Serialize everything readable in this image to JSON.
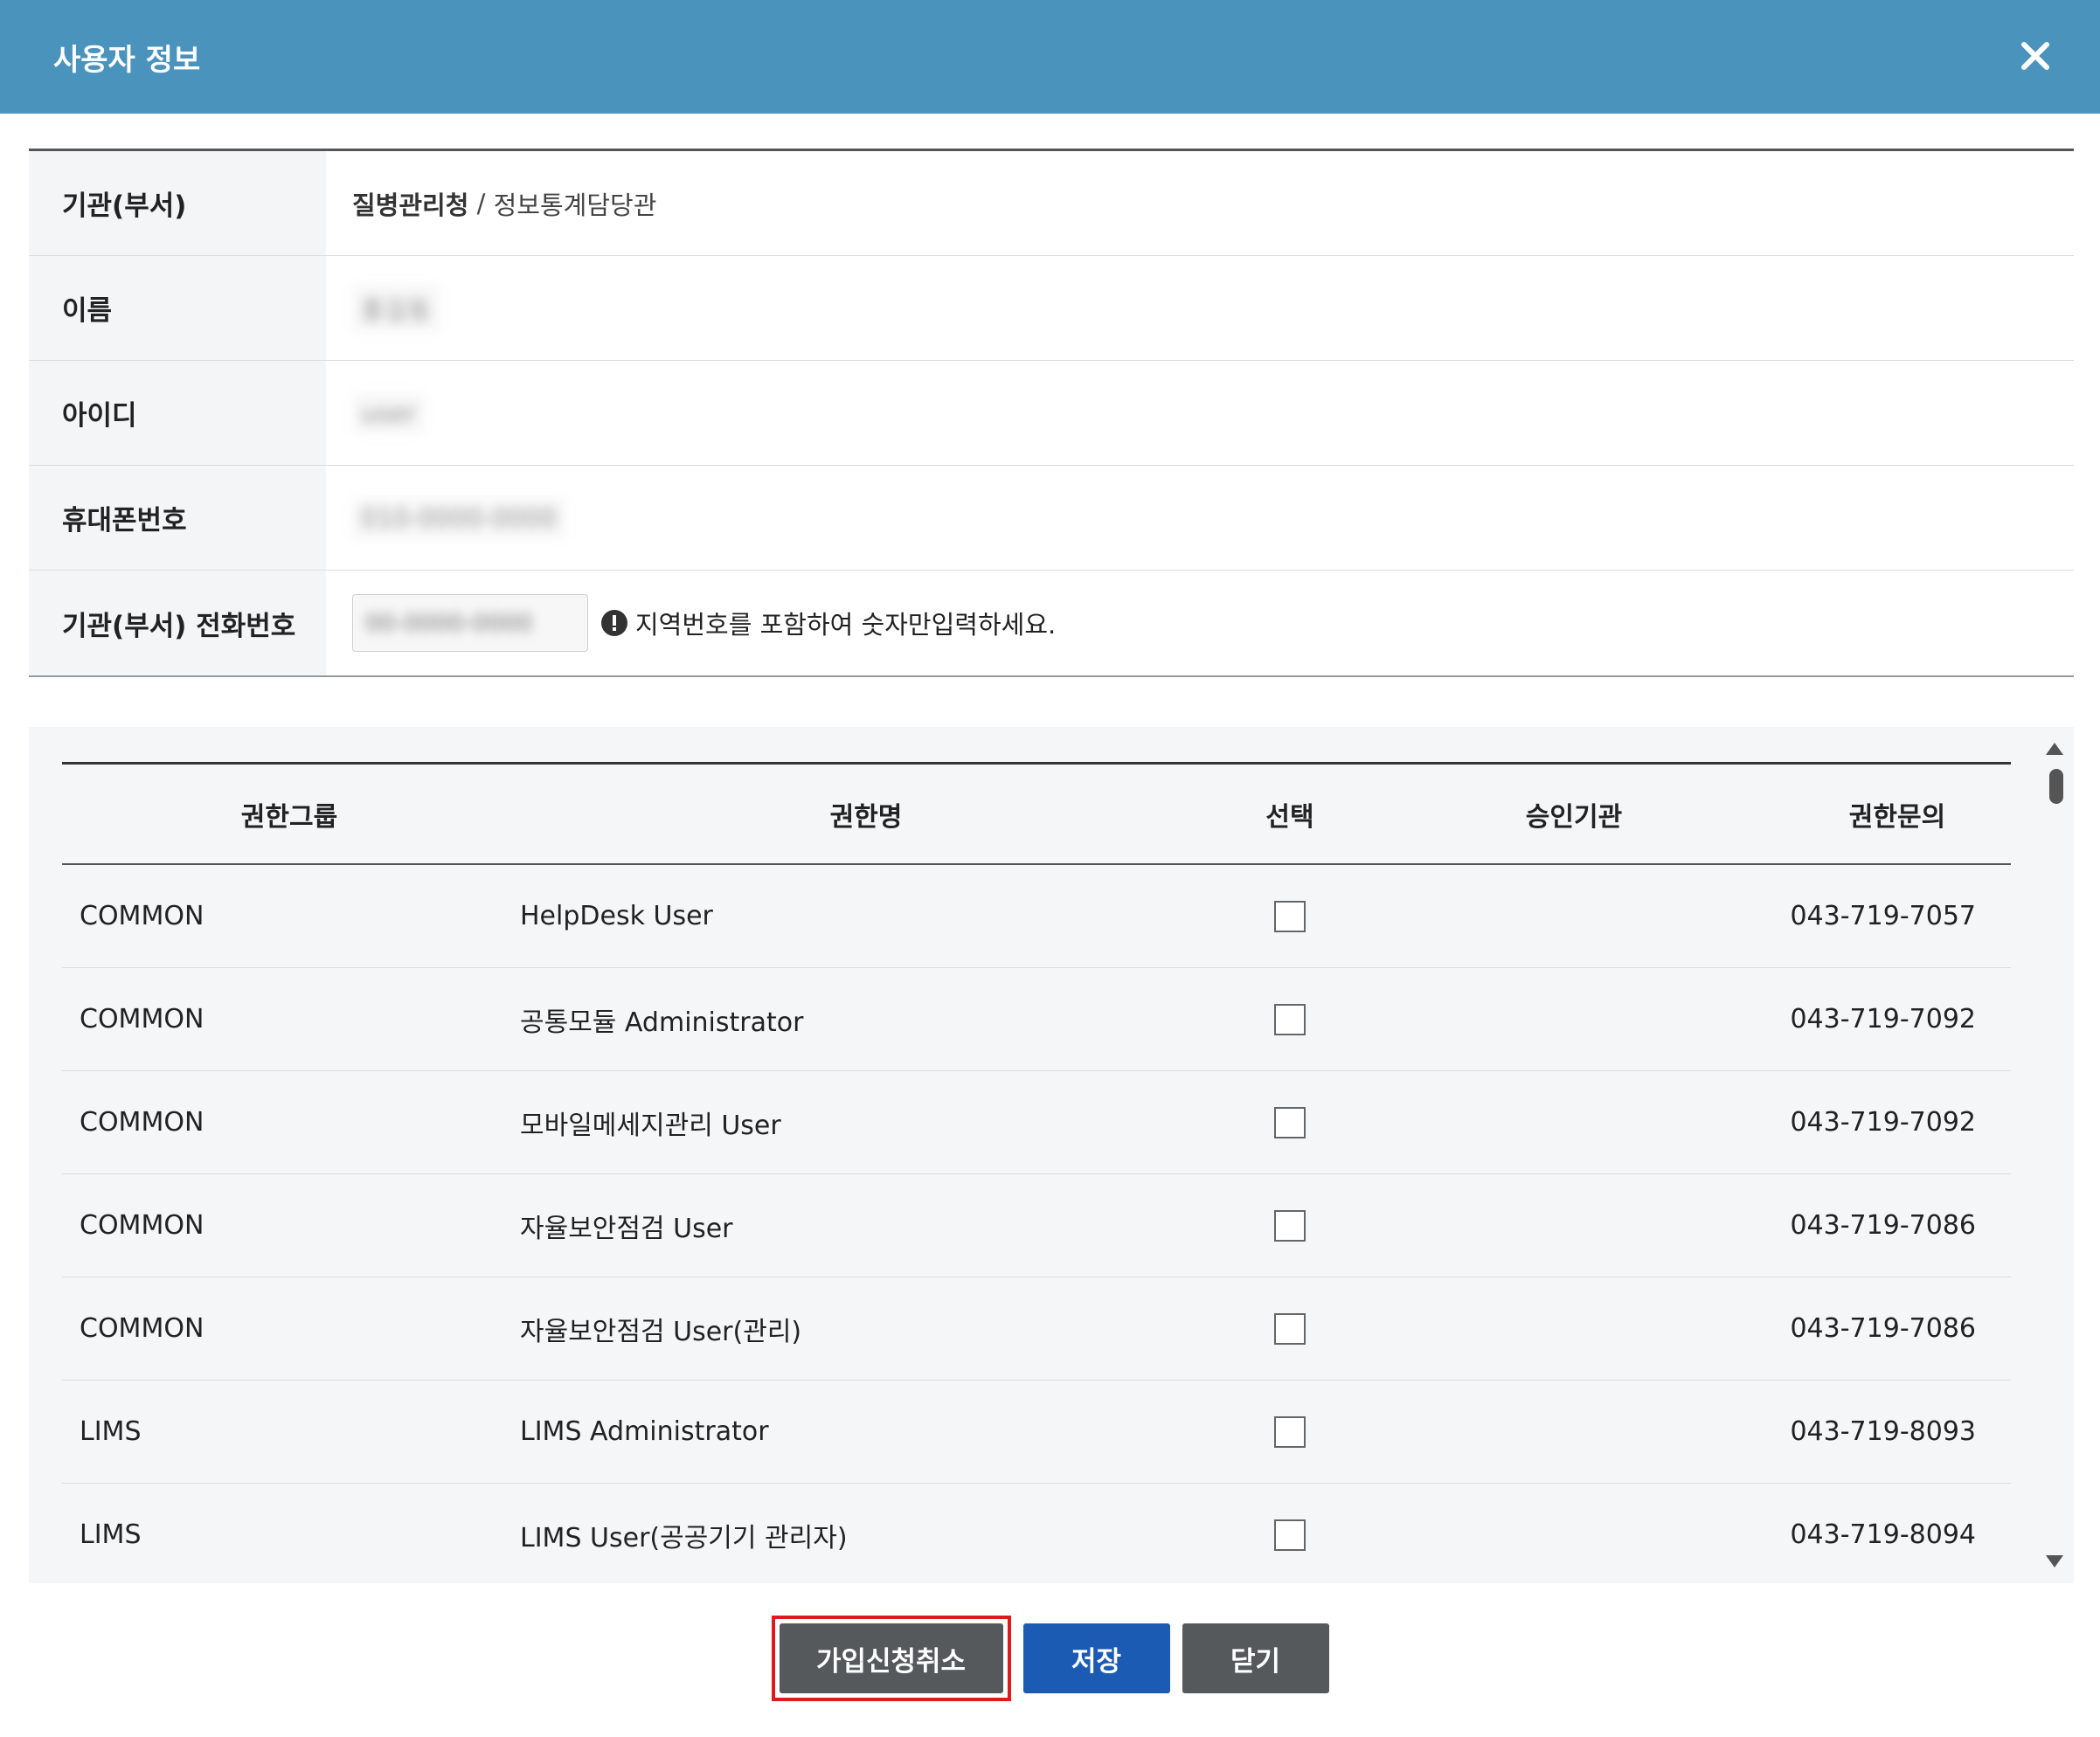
{
  "dialog": {
    "title": "사용자 정보"
  },
  "info": {
    "org_label": "기관(부서)",
    "org_name": "질병관리청",
    "org_sep": " / ",
    "org_dept": "정보통계담당관",
    "name_label": "이름",
    "name_value": "홍길동",
    "id_label": "아이디",
    "id_value": "user",
    "mobile_label": "휴대폰번호",
    "mobile_value": "010-0000-0000",
    "tel_label": "기관(부서) 전화번호",
    "tel_value": "00-0000-0000",
    "tel_hint": "지역번호를 포함하여 숫자만입력하세요."
  },
  "roles": {
    "headers": [
      "권한그룹",
      "권한명",
      "선택",
      "승인기관",
      "권한문의"
    ],
    "rows": [
      {
        "group": "COMMON",
        "name": "HelpDesk User",
        "agency": "",
        "contact": "043-719-7057"
      },
      {
        "group": "COMMON",
        "name": "공통모듈 Administrator",
        "agency": "",
        "contact": "043-719-7092"
      },
      {
        "group": "COMMON",
        "name": "모바일메세지관리 User",
        "agency": "",
        "contact": "043-719-7092"
      },
      {
        "group": "COMMON",
        "name": "자율보안점검 User",
        "agency": "",
        "contact": "043-719-7086"
      },
      {
        "group": "COMMON",
        "name": "자율보안점검 User(관리)",
        "agency": "",
        "contact": "043-719-7086"
      },
      {
        "group": "LIMS",
        "name": "LIMS Administrator",
        "agency": "",
        "contact": "043-719-8093"
      },
      {
        "group": "LIMS",
        "name": "LIMS User(공공기기 관리자)",
        "agency": "",
        "contact": "043-719-8094"
      }
    ]
  },
  "buttons": {
    "cancel_signup": "가입신청취소",
    "save": "저장",
    "close": "닫기"
  },
  "colors": {
    "header_bg": "#4a93bd",
    "save_btn": "#1c5bb4",
    "gray_btn": "#55595c",
    "highlight": "#e0191e"
  }
}
